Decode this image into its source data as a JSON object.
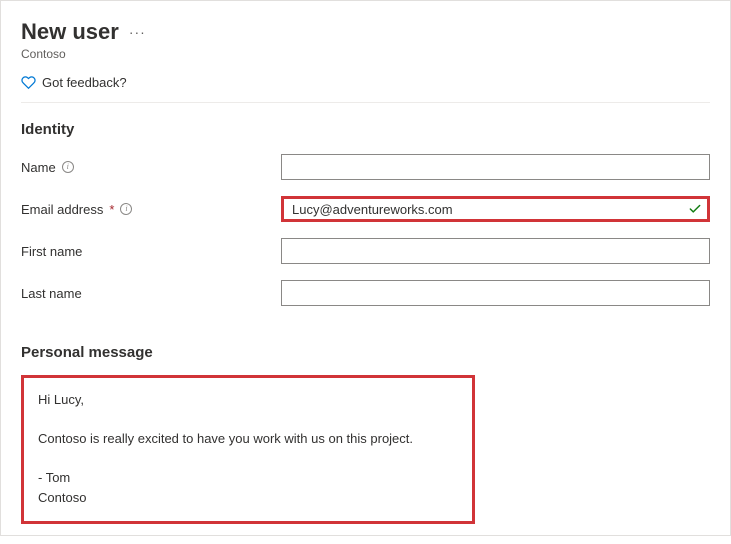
{
  "header": {
    "title": "New user",
    "subtitle": "Contoso",
    "feedback_label": "Got feedback?"
  },
  "sections": {
    "identity_heading": "Identity",
    "personal_heading": "Personal message"
  },
  "fields": {
    "name": {
      "label": "Name",
      "value": ""
    },
    "email": {
      "label": "Email address",
      "value": "Lucy@adventureworks.com"
    },
    "first_name": {
      "label": "First name",
      "value": ""
    },
    "last_name": {
      "label": "Last name",
      "value": ""
    }
  },
  "personal_message": "Hi Lucy,\n\nContoso is really excited to have you work with us on this project.\n\n- Tom\nContoso",
  "colors": {
    "highlight": "#d13438",
    "accent": "#0078d4",
    "success": "#107c10"
  }
}
